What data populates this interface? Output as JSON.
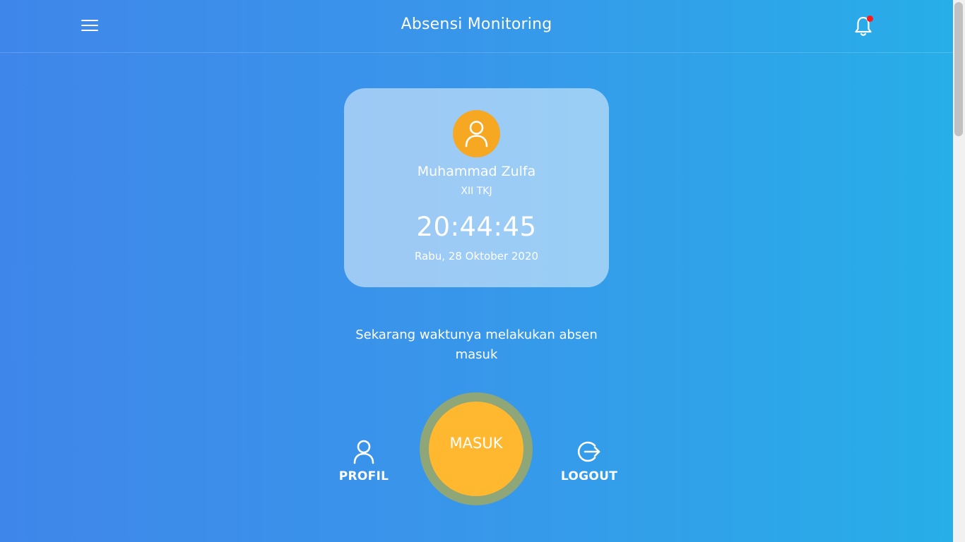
{
  "header": {
    "title": "Absensi Monitoring",
    "menu_icon": "hamburger-menu-icon",
    "notification_icon": "bell-icon",
    "notification_dot_color": "#ff1a1a"
  },
  "profile_card": {
    "avatar_icon": "user-icon",
    "avatar_color": "#f7a823",
    "name": "Muhammad Zulfa",
    "class": "XII TKJ",
    "time": "20:44:45",
    "date": "Rabu, 28 Oktober 2020"
  },
  "message": "Sekarang waktunya melakukan absen masuk",
  "actions": {
    "profil_label": "PROFIL",
    "profil_icon": "user-icon",
    "masuk_label": "MASUK",
    "masuk_color": "#ffb82f",
    "logout_label": "LOGOUT",
    "logout_icon": "logout-icon"
  },
  "colors": {
    "background_start": "#3f86ea",
    "background_end": "#27aee8"
  }
}
